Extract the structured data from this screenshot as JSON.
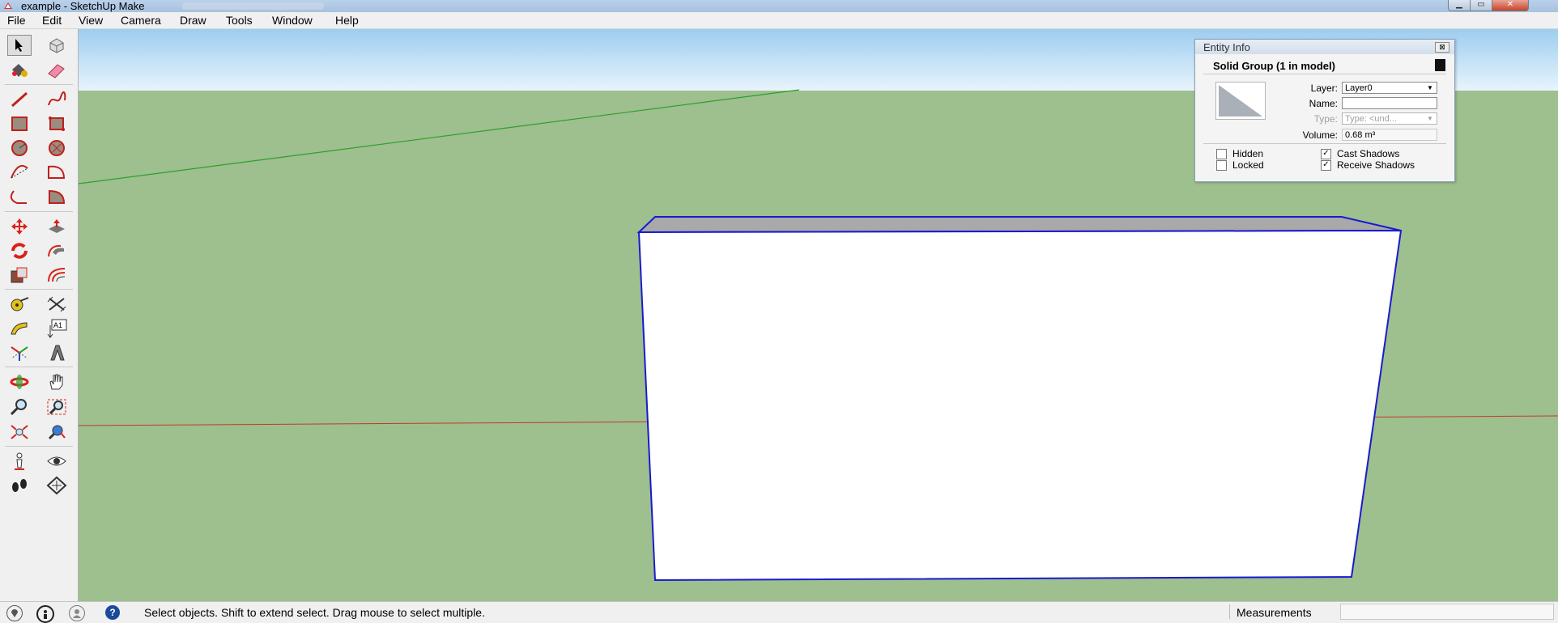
{
  "window": {
    "title": "example - SketchUp Make",
    "controls": [
      "minimize",
      "maximize",
      "close"
    ]
  },
  "menu": [
    "File",
    "Edit",
    "View",
    "Camera",
    "Draw",
    "Tools",
    "Window",
    "Help"
  ],
  "toolbar": {
    "tools": [
      {
        "name": "select-tool-icon",
        "selected": true
      },
      {
        "name": "make-component-icon"
      },
      {
        "name": "paint-bucket-icon"
      },
      {
        "name": "eraser-icon"
      },
      {
        "name": "line-tool-icon"
      },
      {
        "name": "freehand-tool-icon"
      },
      {
        "name": "rectangle-tool-icon"
      },
      {
        "name": "rotated-rectangle-icon"
      },
      {
        "name": "circle-tool-icon"
      },
      {
        "name": "polygon-tool-icon"
      },
      {
        "name": "arc-tool-icon"
      },
      {
        "name": "two-point-arc-icon"
      },
      {
        "name": "three-point-arc-icon"
      },
      {
        "name": "pie-tool-icon"
      },
      {
        "name": "move-tool-icon"
      },
      {
        "name": "push-pull-icon"
      },
      {
        "name": "rotate-tool-icon"
      },
      {
        "name": "follow-me-icon"
      },
      {
        "name": "scale-tool-icon"
      },
      {
        "name": "offset-tool-icon"
      },
      {
        "name": "tape-measure-icon"
      },
      {
        "name": "dimension-tool-icon"
      },
      {
        "name": "protractor-icon"
      },
      {
        "name": "text-tool-icon"
      },
      {
        "name": "axes-tool-icon"
      },
      {
        "name": "3d-text-icon"
      },
      {
        "name": "orbit-tool-icon"
      },
      {
        "name": "pan-tool-icon"
      },
      {
        "name": "zoom-tool-icon"
      },
      {
        "name": "zoom-window-icon"
      },
      {
        "name": "zoom-extents-icon"
      },
      {
        "name": "previous-view-icon"
      },
      {
        "name": "position-camera-icon"
      },
      {
        "name": "look-around-icon"
      },
      {
        "name": "walk-tool-icon"
      },
      {
        "name": "section-plane-icon"
      }
    ],
    "text_label_glyph": "A1"
  },
  "entity_info": {
    "title": "Entity Info",
    "close_glyph": "⊠",
    "header": "Solid Group (1 in model)",
    "layer_label": "Layer:",
    "layer_value": "Layer0",
    "name_label": "Name:",
    "name_value": "",
    "type_label": "Type:",
    "type_value": "Type: <und...",
    "volume_label": "Volume:",
    "volume_value": "0.68 m³",
    "hidden_label": "Hidden",
    "hidden_checked": false,
    "locked_label": "Locked",
    "locked_checked": false,
    "cast_shadows_label": "Cast Shadows",
    "cast_shadows_checked": true,
    "receive_shadows_label": "Receive Shadows",
    "receive_shadows_checked": true,
    "check_glyph": "✓"
  },
  "status": {
    "text": "Select objects. Shift to extend select. Drag mouse to select multiple.",
    "measurements_label": "Measurements",
    "measurements_value": "",
    "help_glyph": "?"
  },
  "colors": {
    "sky_top": "#9ecdf0",
    "ground": "#9ebf8e",
    "selection_edge": "#1a1ad0",
    "green_axis": "#2ca02c",
    "red_axis": "#c0392b",
    "box_top": "#a9a9a9",
    "box_front": "#ffffff"
  }
}
